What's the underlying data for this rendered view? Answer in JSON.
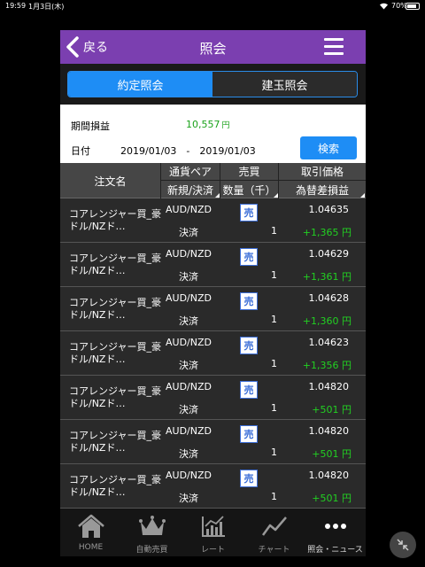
{
  "status_bar": {
    "time": "19:59",
    "date": "1月3日(木)",
    "battery": "70%"
  },
  "header": {
    "back_label": "戻る",
    "title": "照会"
  },
  "tabs": [
    {
      "label": "約定照会",
      "active": true
    },
    {
      "label": "建玉照会",
      "active": false
    }
  ],
  "summary": {
    "pl_label": "期間損益",
    "pl_value": "10,557",
    "pl_unit": "円",
    "date_label": "日付",
    "date_range": "2019/01/03　-　2019/01/03",
    "search_label": "検索"
  },
  "table": {
    "headers": {
      "name": "注文名",
      "pair": "通貨ペア",
      "new_close": "新規/決済",
      "side": "売買",
      "qty": "数量（千）",
      "price": "取引価格",
      "pnl": "為替差損益"
    },
    "rows": [
      {
        "name": "コアレンジャー買_豪ドル/NZド…",
        "pair": "AUD/NZD",
        "kind": "決済",
        "side": "売",
        "qty": "1",
        "price": "1.04635",
        "pnl": "+1,365 円"
      },
      {
        "name": "コアレンジャー買_豪ドル/NZド…",
        "pair": "AUD/NZD",
        "kind": "決済",
        "side": "売",
        "qty": "1",
        "price": "1.04629",
        "pnl": "+1,361 円"
      },
      {
        "name": "コアレンジャー買_豪ドル/NZド…",
        "pair": "AUD/NZD",
        "kind": "決済",
        "side": "売",
        "qty": "1",
        "price": "1.04628",
        "pnl": "+1,360 円"
      },
      {
        "name": "コアレンジャー買_豪ドル/NZド…",
        "pair": "AUD/NZD",
        "kind": "決済",
        "side": "売",
        "qty": "1",
        "price": "1.04623",
        "pnl": "+1,356 円"
      },
      {
        "name": "コアレンジャー買_豪ドル/NZド…",
        "pair": "AUD/NZD",
        "kind": "決済",
        "side": "売",
        "qty": "1",
        "price": "1.04820",
        "pnl": "+501 円"
      },
      {
        "name": "コアレンジャー買_豪ドル/NZド…",
        "pair": "AUD/NZD",
        "kind": "決済",
        "side": "売",
        "qty": "1",
        "price": "1.04820",
        "pnl": "+501 円"
      },
      {
        "name": "コアレンジャー買_豪ドル/NZド…",
        "pair": "AUD/NZD",
        "kind": "決済",
        "side": "売",
        "qty": "1",
        "price": "1.04820",
        "pnl": "+501 円"
      }
    ]
  },
  "tabbar": [
    {
      "label": "HOME",
      "icon": "home-icon"
    },
    {
      "label": "自動売買",
      "icon": "crown-icon"
    },
    {
      "label": "レート",
      "icon": "rate-chart-icon"
    },
    {
      "label": "チャート",
      "icon": "line-chart-icon"
    },
    {
      "label": "照会・ニュース",
      "icon": "more-icon",
      "active": true
    }
  ],
  "colors": {
    "header": "#7b3fb0",
    "accent": "#1e8df5",
    "profit": "#22d022"
  }
}
